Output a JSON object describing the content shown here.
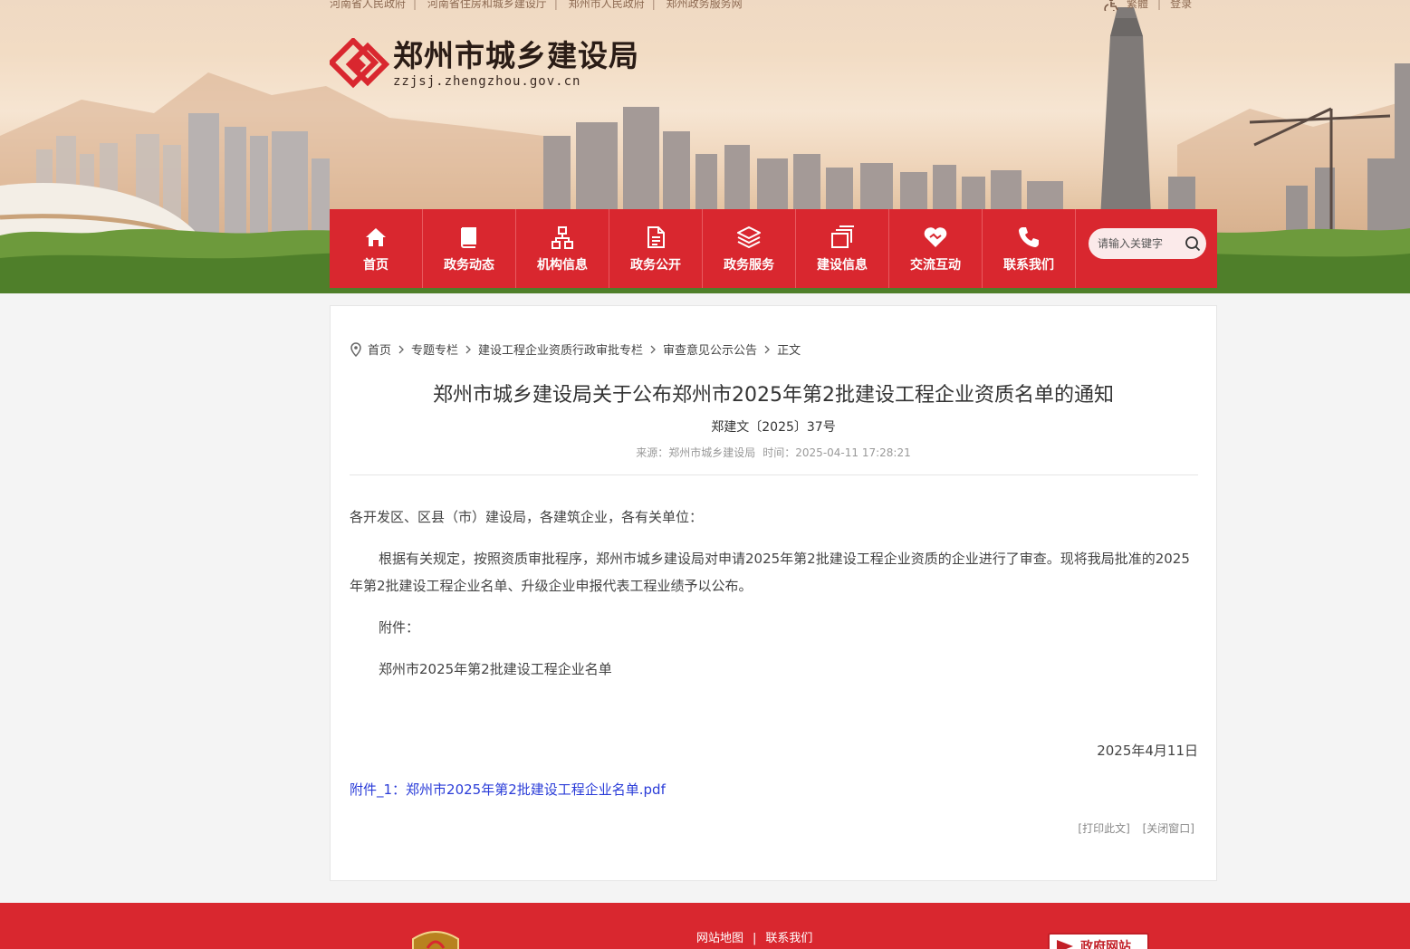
{
  "top_links": [
    "河南省人民政府",
    "河南省住房和城乡建设厅",
    "郑州市人民政府",
    "郑州政务服务网"
  ],
  "top_right": {
    "accessibility_icon": "accessibility-icon",
    "lang": "繁體",
    "login": "登录"
  },
  "logo": {
    "title": "郑州市城乡建设局",
    "url": "zzjsj.zhengzhou.gov.cn"
  },
  "nav": {
    "items": [
      {
        "label": "首页",
        "icon": "home-icon"
      },
      {
        "label": "政务动态",
        "icon": "book-icon"
      },
      {
        "label": "机构信息",
        "icon": "org-chart-icon"
      },
      {
        "label": "政务公开",
        "icon": "document-icon"
      },
      {
        "label": "政务服务",
        "icon": "layers-icon"
      },
      {
        "label": "建设信息",
        "icon": "stacked-pages-icon"
      },
      {
        "label": "交流互动",
        "icon": "handshake-heart-icon"
      },
      {
        "label": "联系我们",
        "icon": "phone-icon"
      }
    ],
    "search_placeholder": "请输入关键字"
  },
  "breadcrumb": [
    "首页",
    "专题专栏",
    "建设工程企业资质行政审批专栏",
    "审查意见公示公告",
    "正文"
  ],
  "article": {
    "title": "郑州市城乡建设局关于公布郑州市2025年第2批建设工程企业资质名单的通知",
    "doc_number": "郑建文〔2025〕37号",
    "source": "来源：郑州市城乡建设局",
    "time": "时间：2025-04-11 17:28:21",
    "salutation": "各开发区、区县（市）建设局，各建筑企业，各有关单位：",
    "paragraph": "根据有关规定，按照资质审批程序，郑州市城乡建设局对申请2025年第2批建设工程企业资质的企业进行了审查。现将我局批准的2025年第2批建设工程企业名单、升级企业申报代表工程业绩予以公布。",
    "attachment_heading": "附件：",
    "attachment_item": "郑州市2025年第2批建设工程企业名单",
    "date": "2025年4月11日",
    "attachment_link": "附件_1：郑州市2025年第2批建设工程企业名单.pdf",
    "print": "[打印此文]",
    "close": "[关闭窗口]"
  },
  "footer": {
    "links": [
      "网站地图",
      "联系我们"
    ],
    "gov_badge": "政府网站"
  },
  "colors": {
    "brand_red": "#d9272f",
    "link_blue": "#2a3cd8"
  }
}
